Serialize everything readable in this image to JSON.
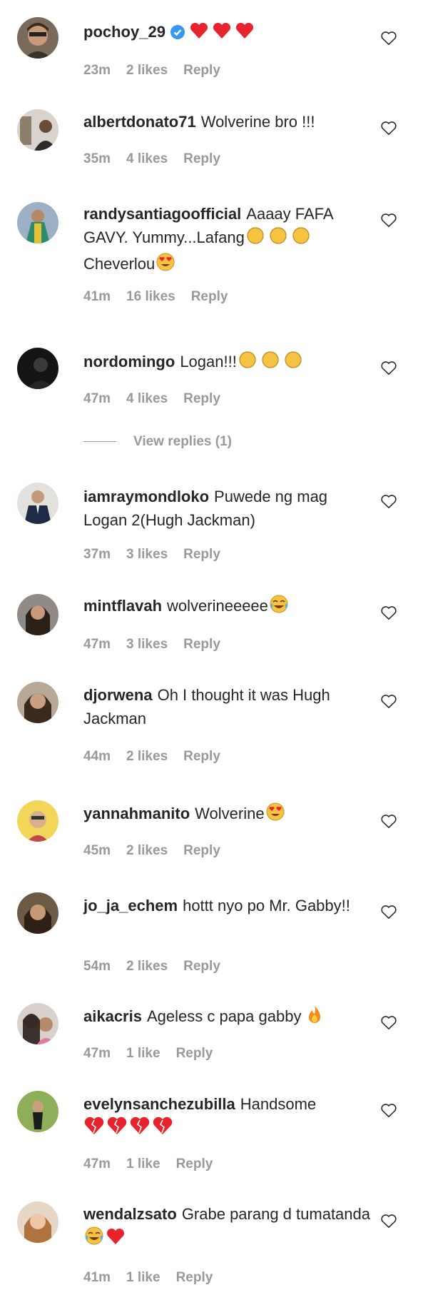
{
  "comments": [
    {
      "user": "pochoy_29",
      "text": "",
      "time": "23m",
      "likes": "2 likes",
      "reply": "Reply",
      "verified": true
    },
    {
      "user": "albertdonato71",
      "text": "Wolverine bro !!!",
      "time": "35m",
      "likes": "4 likes",
      "reply": "Reply"
    },
    {
      "user": "randysantiagoofficial",
      "text": "Aaaay FAFA GAVY. Yummy...Lafang",
      "text2": "Cheverlou",
      "time": "41m",
      "likes": "16 likes",
      "reply": "Reply"
    },
    {
      "user": "nordomingo",
      "text": "Logan!!!",
      "time": "47m",
      "likes": "4 likes",
      "reply": "Reply"
    },
    {
      "user": "iamraymondloko",
      "text": "Puwede ng mag Logan 2(Hugh Jackman)",
      "time": "37m",
      "likes": "3 likes",
      "reply": "Reply"
    },
    {
      "user": "mintflavah",
      "text": "wolverineeeee",
      "time": "47m",
      "likes": "3 likes",
      "reply": "Reply"
    },
    {
      "user": "djorwena",
      "text": "Oh I thought it was Hugh Jackman",
      "time": "44m",
      "likes": "2 likes",
      "reply": "Reply"
    },
    {
      "user": "yannahmanito",
      "text": "Wolverine",
      "time": "45m",
      "likes": "2 likes",
      "reply": "Reply"
    },
    {
      "user": "jo_ja_echem",
      "text": "hottt nyo po Mr. Gabby!!",
      "time": "54m",
      "likes": "2 likes",
      "reply": "Reply"
    },
    {
      "user": "aikacris",
      "text": "Ageless c papa gabby",
      "time": "47m",
      "likes": "1 like",
      "reply": "Reply"
    },
    {
      "user": "evelynsanchezubilla",
      "text": "Handsome",
      "time": "47m",
      "likes": "1 like",
      "reply": "Reply"
    },
    {
      "user": "wendalzsato",
      "text": "Grabe parang d tumatanda",
      "time": "41m",
      "likes": "1 like",
      "reply": "Reply"
    }
  ],
  "view_replies": "View replies (1)",
  "icons": {
    "like": "heart-outline-icon",
    "verified": "verified-badge-icon"
  },
  "colors": {
    "text": "#262626",
    "meta": "#999999",
    "verified": "#3897f0",
    "heart_emoji": "#e8232d",
    "clap_emoji": "#f5c242"
  }
}
